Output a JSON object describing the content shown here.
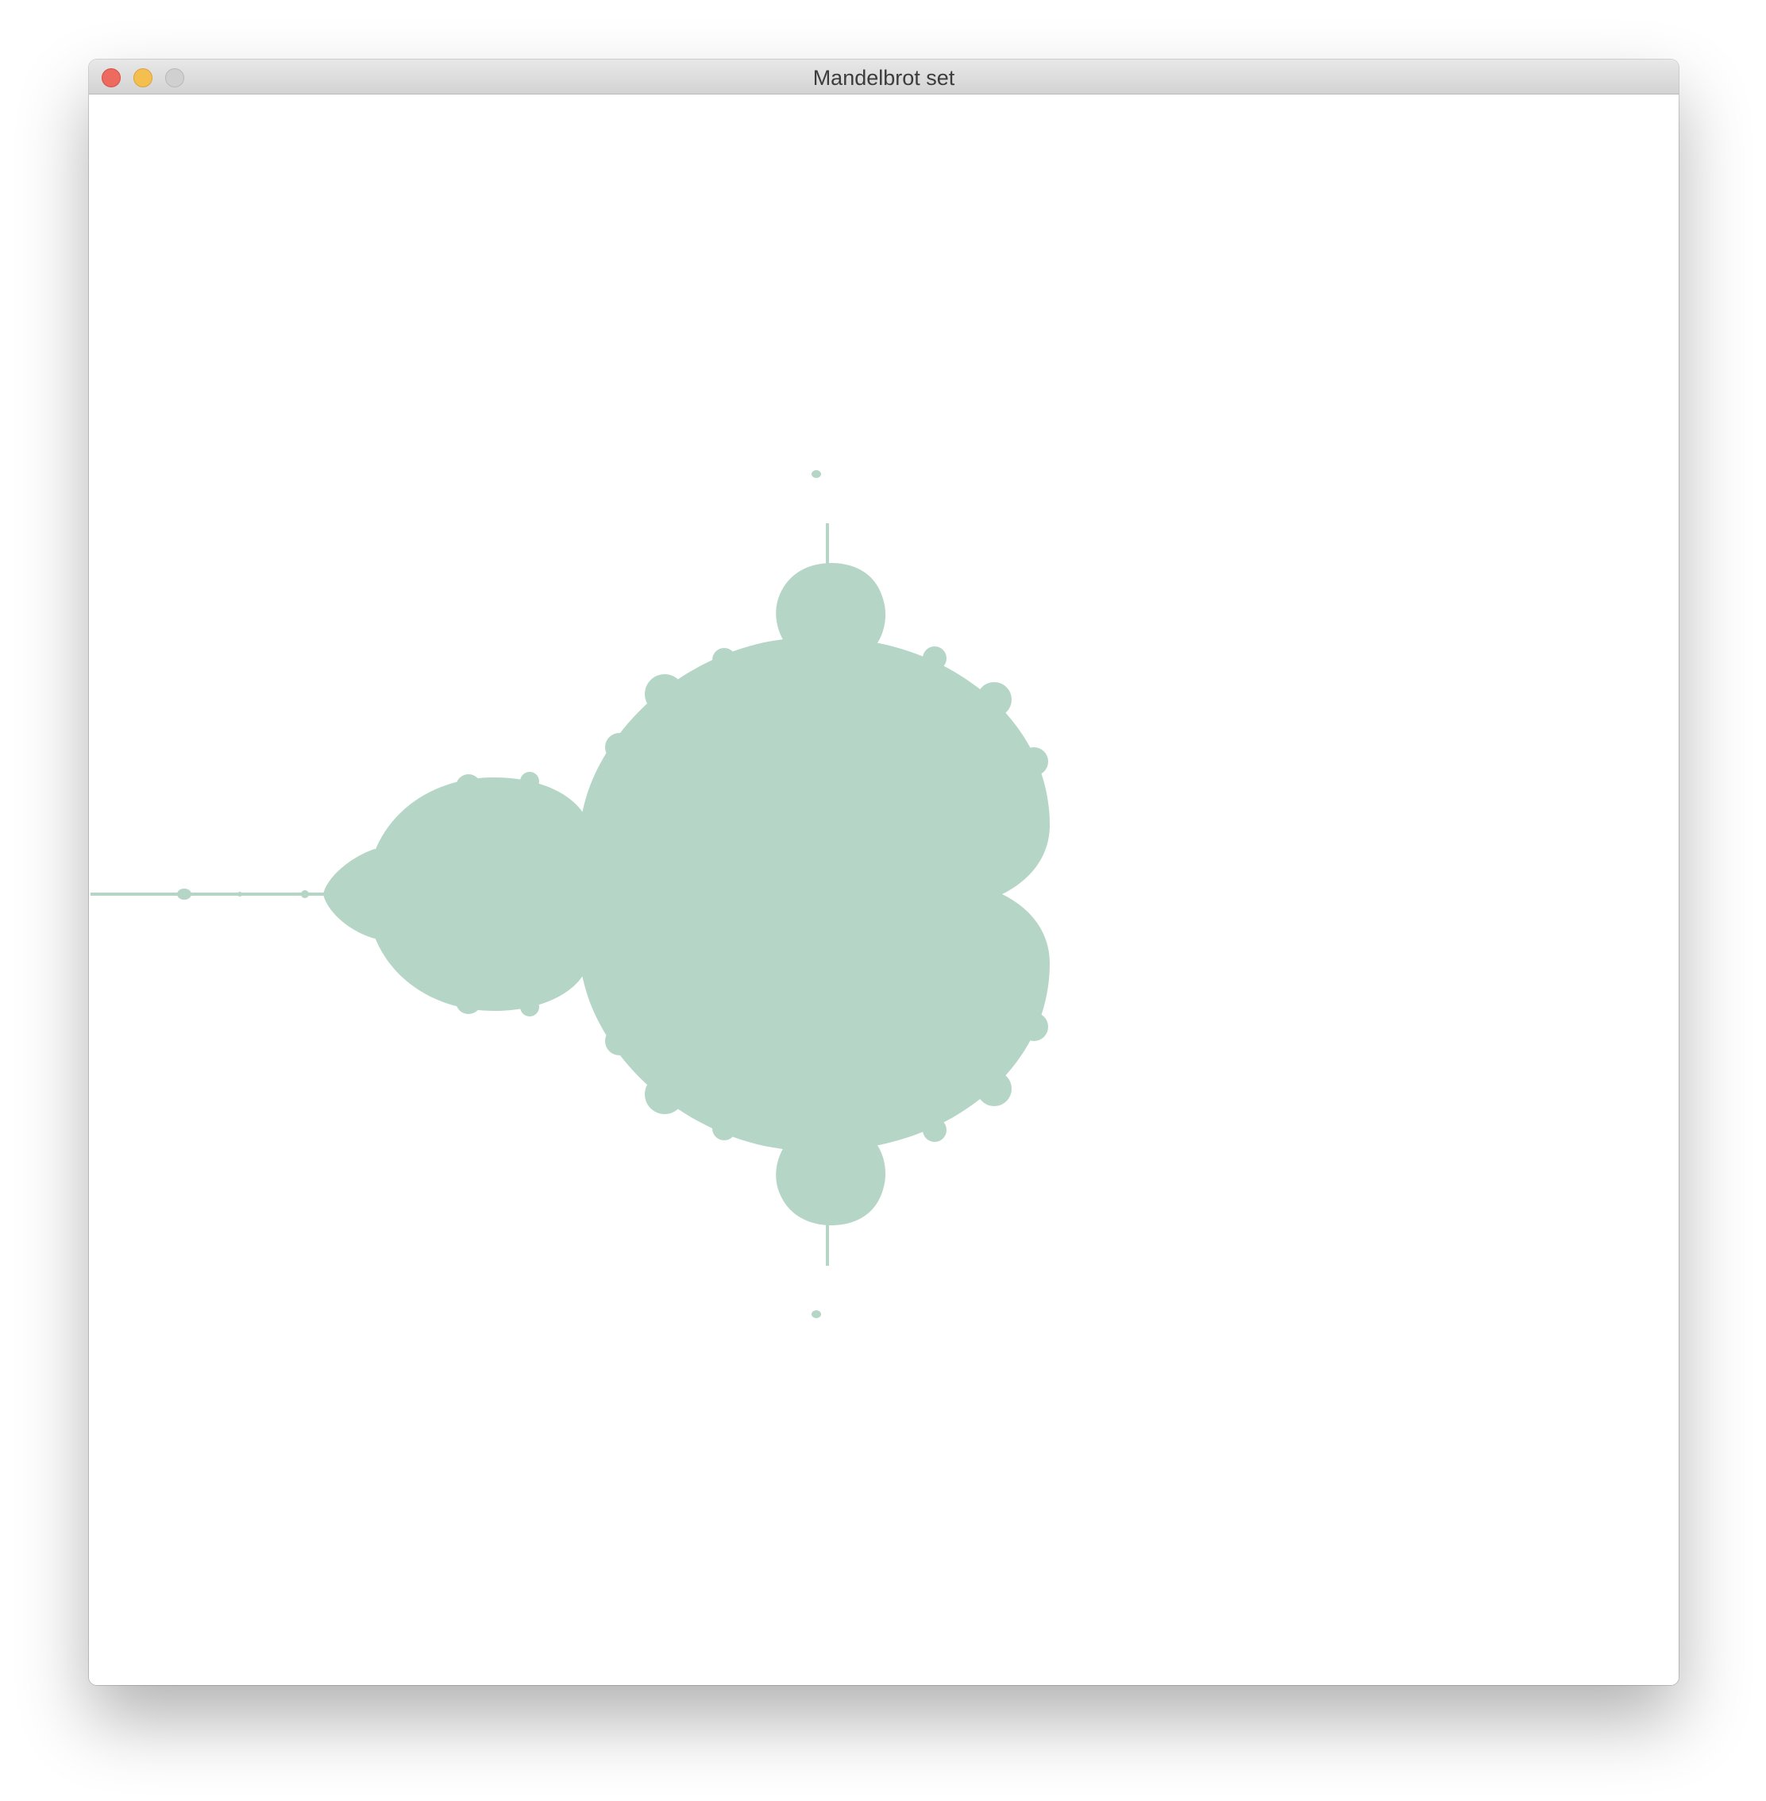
{
  "window": {
    "title": "Mandelbrot set",
    "controls": [
      "close-icon",
      "minimize-icon",
      "zoom-icon"
    ]
  },
  "canvas": {
    "fill_color": "#b5d6c6",
    "background_color": "#ffffff"
  }
}
